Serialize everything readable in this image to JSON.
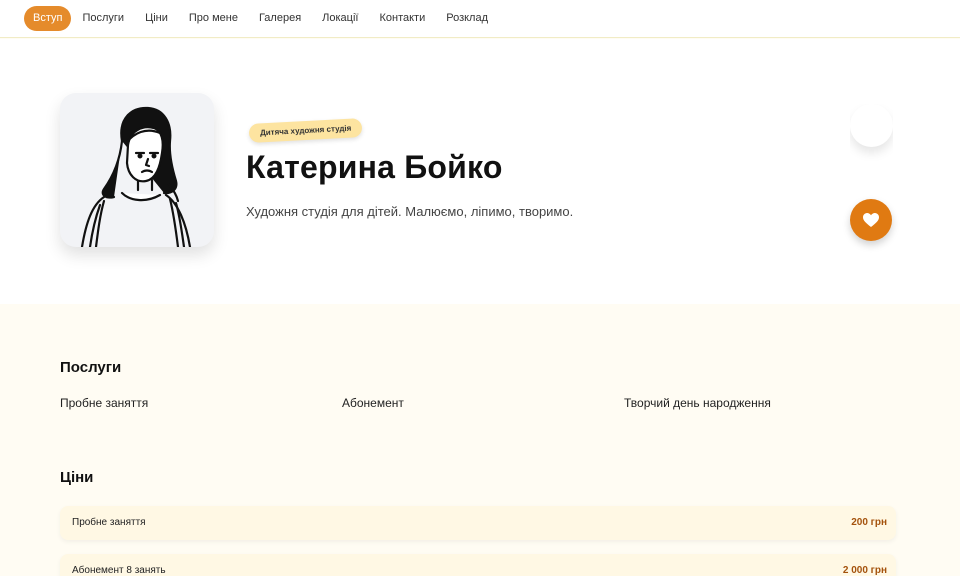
{
  "nav": {
    "items": [
      "Вступ",
      "Послуги",
      "Ціни",
      "Про мене",
      "Галерея",
      "Локації",
      "Контакти",
      "Розклад"
    ],
    "active": "Вступ"
  },
  "hero": {
    "badge": "Дитяча художня студія",
    "name": "Катерина Бойко",
    "tagline": "Художня студія для дітей. Малюємо, ліпимо, творимо."
  },
  "services": {
    "title": "Послуги",
    "items": [
      "Пробне заняття",
      "Абонемент",
      "Творчий день народження"
    ]
  },
  "prices": {
    "title": "Ціни",
    "items": [
      {
        "name": "Пробне заняття",
        "price": "200 грн"
      },
      {
        "name": "Абонемент 8 занять",
        "price": "2 000 грн"
      }
    ]
  },
  "colors": {
    "accent": "#e58b2b",
    "heart_bubble": "#e07a12",
    "price_text": "#a4520c"
  }
}
